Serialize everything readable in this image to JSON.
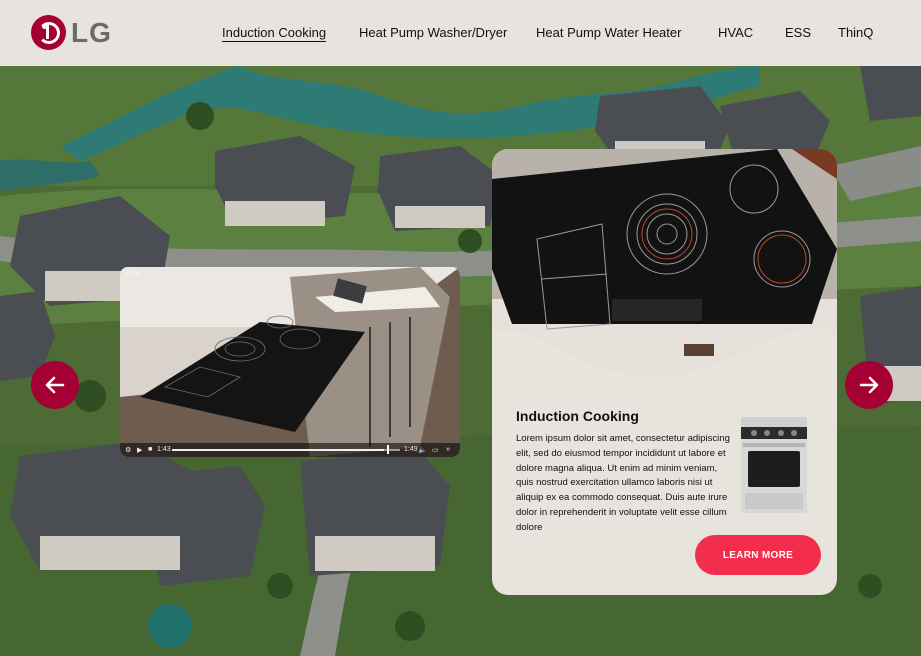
{
  "brand": {
    "logo_text": "LG",
    "logo_icon": "lg-logo-icon",
    "accent": "#a50034"
  },
  "nav": {
    "items": [
      {
        "label": "Induction Cooking",
        "active": true
      },
      {
        "label": "Heat Pump Washer/Dryer"
      },
      {
        "label": "Heat Pump Water Heater"
      },
      {
        "label": "HVAC"
      },
      {
        "label": "ESS"
      },
      {
        "label": "ThinQ"
      }
    ]
  },
  "video": {
    "current_time": "1:43",
    "duration": "1:49",
    "progress": 0.93,
    "icons": [
      "settings-icon",
      "play-icon",
      "stop-icon",
      "volume-icon",
      "screen-icon",
      "fullscreen-icon"
    ]
  },
  "card": {
    "title": "Induction Cooking",
    "body": "Lorem ipsum dolor sit amet, consectetur adipiscing elit, sed do eiusmod tempor incididunt ut labore et dolore magna aliqua. Ut enim ad minim veniam, quis nostrud exercitation ullamco laboris nisi ut aliquip ex ea commodo consequat. Duis aute irure dolor in reprehenderit in voluptate velit esse cillum dolore",
    "button_label": "LEARN MORE",
    "button_color": "#f22e4c"
  },
  "carousel": {
    "prev_icon": "arrow-left-icon",
    "next_icon": "arrow-right-icon"
  }
}
